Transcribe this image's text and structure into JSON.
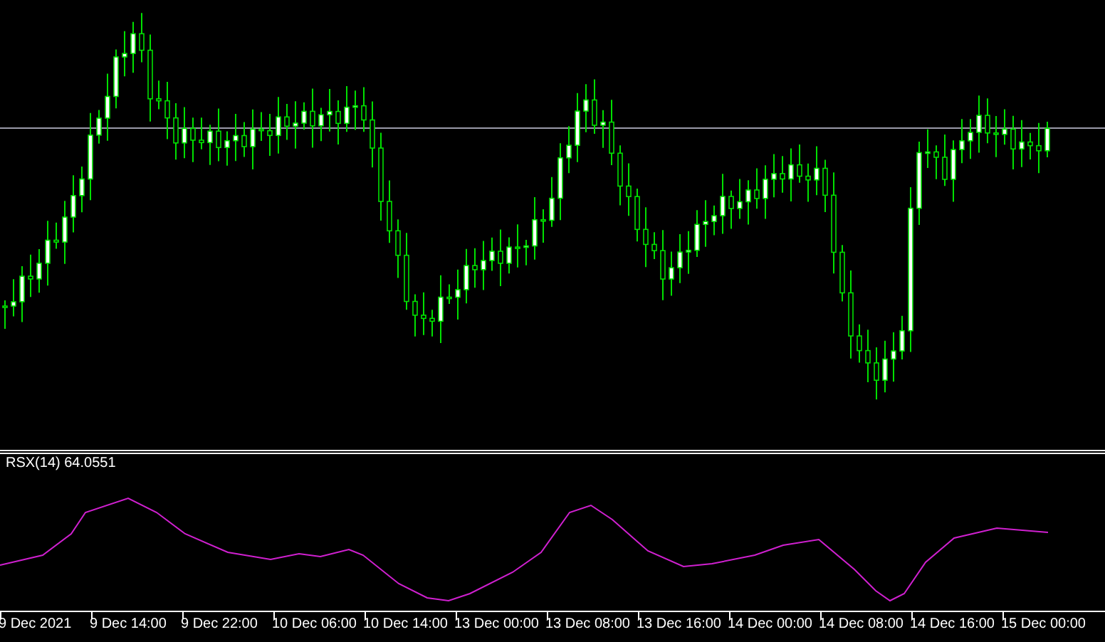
{
  "indicator": {
    "label": "RSX(14) 64.0551"
  },
  "time_axis": {
    "labels": [
      "9 Dec 2021",
      "9 Dec 14:00",
      "9 Dec 22:00",
      "10 Dec 06:00",
      "10 Dec 14:00",
      "13 Dec 00:00",
      "13 Dec 08:00",
      "13 Dec 16:00",
      "14 Dec 00:00",
      "14 Dec 08:00",
      "14 Dec 16:00",
      "15 Dec 00:00"
    ]
  }
}
